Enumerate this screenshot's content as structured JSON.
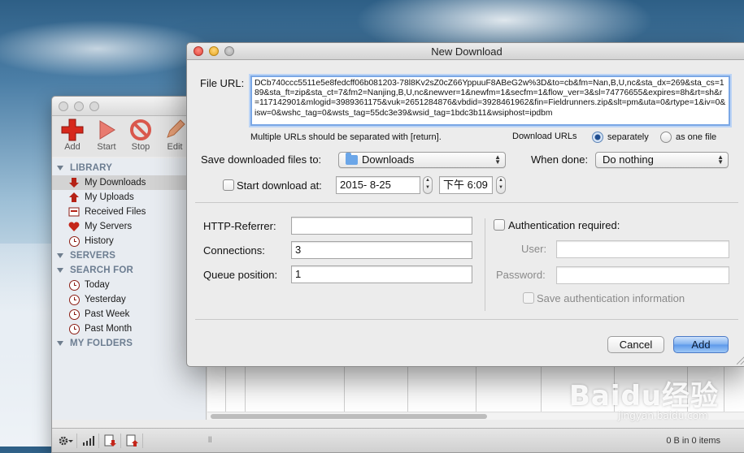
{
  "app": {
    "toolbar": [
      {
        "label": "Add",
        "icon": "add-icon"
      },
      {
        "label": "Start",
        "icon": "start-icon"
      },
      {
        "label": "Stop",
        "icon": "stop-icon"
      },
      {
        "label": "Edit",
        "icon": "edit-icon"
      }
    ],
    "sidebar": {
      "library_header": "LIBRARY",
      "library_items": [
        {
          "label": "My Downloads",
          "icon": "download-arrow-icon",
          "selected": true
        },
        {
          "label": "My Uploads",
          "icon": "upload-arrow-icon"
        },
        {
          "label": "Received Files",
          "icon": "received-files-icon"
        },
        {
          "label": "My Servers",
          "icon": "heart-icon"
        },
        {
          "label": "History",
          "icon": "clock-icon"
        }
      ],
      "servers_header": "SERVERS",
      "search_header": "SEARCH FOR",
      "search_items": [
        {
          "label": "Today",
          "icon": "clock-icon"
        },
        {
          "label": "Yesterday",
          "icon": "clock-icon"
        },
        {
          "label": "Past Week",
          "icon": "clock-icon"
        },
        {
          "label": "Past Month",
          "icon": "clock-icon"
        }
      ],
      "folders_header": "MY FOLDERS"
    },
    "status": "0 B in 0 items"
  },
  "dialog": {
    "title": "New Download",
    "file_url_label": "File URL:",
    "file_url_value": "DCb740ccc5511e5e8fedcff06b081203-78l8Kv2sZ0cZ66YppuuF8ABeG2w%3D&to=cb&fm=Nan,B,U,nc&sta_dx=269&sta_cs=189&sta_ft=zip&sta_ct=7&fm2=Nanjing,B,U,nc&newver=1&newfm=1&secfm=1&flow_ver=3&sl=74776655&expires=8h&rt=sh&r=117142901&mlogid=3989361175&vuk=2651284876&vbdid=3928461962&fin=Fieldrunners.zip&slt=pm&uta=0&rtype=1&iv=0&isw=0&wshc_tag=0&wsts_tag=55dc3e39&wsid_tag=1bdc3b11&wsiphost=ipdbm",
    "hint": "Multiple URLs should be separated with [return].",
    "download_urls_label": "Download URLs",
    "separately_label": "separately",
    "as_one_file_label": "as one file",
    "save_to_label": "Save downloaded files to:",
    "save_to_value": "Downloads",
    "when_done_label": "When done:",
    "when_done_value": "Do nothing",
    "start_at_label": "Start download at:",
    "start_date": "2015- 8-25",
    "start_time": "下午 6:09",
    "http_referrer_label": "HTTP-Referrer:",
    "http_referrer_value": "",
    "connections_label": "Connections:",
    "connections_value": "3",
    "queue_position_label": "Queue position:",
    "queue_position_value": "1",
    "auth_required_label": "Authentication required:",
    "user_label": "User:",
    "password_label": "Password:",
    "save_auth_label": "Save authentication information",
    "cancel_label": "Cancel",
    "add_label": "Add"
  },
  "watermark": {
    "main": "Baidu经验",
    "sub": "jingyan.baidu.com"
  }
}
